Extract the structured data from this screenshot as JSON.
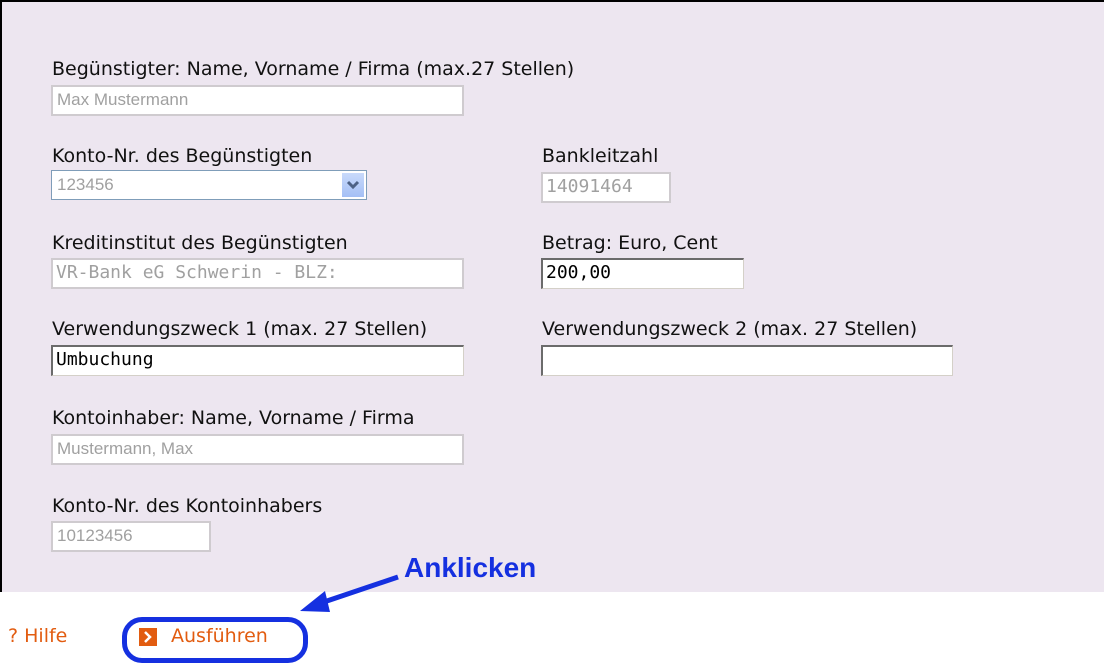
{
  "form": {
    "beneficiary_name": {
      "label": "Begünstigter: Name, Vorname / Firma (max.27 Stellen)",
      "value": "Max Mustermann"
    },
    "beneficiary_account": {
      "label": "Konto-Nr. des Begünstigten",
      "selected": "123456"
    },
    "bank_code": {
      "label": "Bankleitzahl",
      "value": "14091464"
    },
    "bank_institution": {
      "label": "Kreditinstitut des Begünstigten",
      "value": "VR-Bank eG Schwerin - BLZ:"
    },
    "amount": {
      "label": "Betrag: Euro, Cent",
      "value": "200,00"
    },
    "purpose1": {
      "label": "Verwendungszweck 1 (max. 27 Stellen)",
      "value": "Umbuchung"
    },
    "purpose2": {
      "label": "Verwendungszweck 2 (max. 27 Stellen)",
      "value": ""
    },
    "holder_name": {
      "label": "Kontoinhaber: Name, Vorname / Firma",
      "value": "Mustermann, Max"
    },
    "holder_account": {
      "label": "Konto-Nr. des Kontoinhabers",
      "value": "10123456"
    }
  },
  "actions": {
    "help_label": "? Hilfe",
    "execute_label": "Ausführen"
  },
  "annotation": {
    "callout_text": "Anklicken",
    "color": "#1530e0"
  },
  "icons": [
    "chevron-down-icon",
    "arrow-right-icon"
  ],
  "colors": {
    "panel_bg": "#ede6f0",
    "link_orange": "#e25c10",
    "annotation_blue": "#1530e0"
  }
}
